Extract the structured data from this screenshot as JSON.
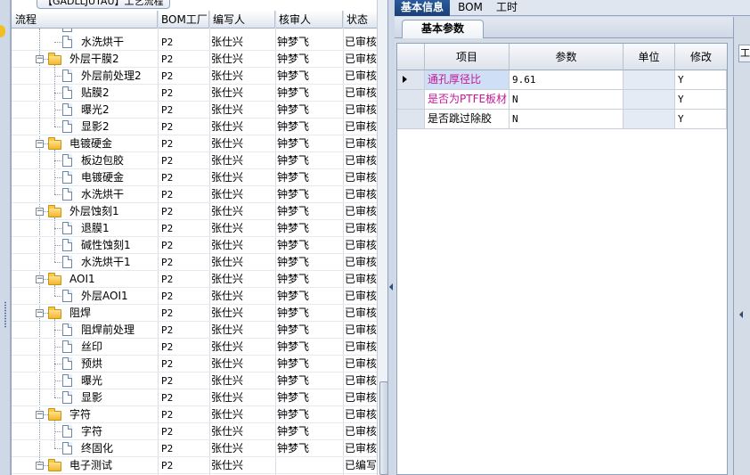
{
  "tree_panel": {
    "tab_title": "【GADLLJUTAU】工艺流程",
    "columns": [
      "流程",
      "BOM工厂",
      "编写人",
      "核审人",
      "状态"
    ]
  },
  "tree_rows": [
    {
      "level": 2,
      "type": "file",
      "name": "水洗烘干",
      "bom": "P2",
      "author": "张仕兴",
      "reviewer": "钟梦飞",
      "status": "已审核"
    },
    {
      "level": 1,
      "type": "folder",
      "name": "外层干膜2",
      "bom": "P2",
      "author": "张仕兴",
      "reviewer": "钟梦飞",
      "status": "已审核"
    },
    {
      "level": 2,
      "type": "file",
      "name": "外层前处理2",
      "bom": "P2",
      "author": "张仕兴",
      "reviewer": "钟梦飞",
      "status": "已审核"
    },
    {
      "level": 2,
      "type": "file",
      "name": "贴膜2",
      "bom": "P2",
      "author": "张仕兴",
      "reviewer": "钟梦飞",
      "status": "已审核"
    },
    {
      "level": 2,
      "type": "file",
      "name": "曝光2",
      "bom": "P2",
      "author": "张仕兴",
      "reviewer": "钟梦飞",
      "status": "已审核"
    },
    {
      "level": 2,
      "type": "file",
      "name": "显影2",
      "bom": "P2",
      "author": "张仕兴",
      "reviewer": "钟梦飞",
      "status": "已审核"
    },
    {
      "level": 1,
      "type": "folder",
      "name": "电镀硬金",
      "bom": "P2",
      "author": "张仕兴",
      "reviewer": "钟梦飞",
      "status": "已审核"
    },
    {
      "level": 2,
      "type": "file",
      "name": "板边包胶",
      "bom": "P2",
      "author": "张仕兴",
      "reviewer": "钟梦飞",
      "status": "已审核"
    },
    {
      "level": 2,
      "type": "file",
      "name": "电镀硬金",
      "bom": "P2",
      "author": "张仕兴",
      "reviewer": "钟梦飞",
      "status": "已审核"
    },
    {
      "level": 2,
      "type": "file",
      "name": "水洗烘干",
      "bom": "P2",
      "author": "张仕兴",
      "reviewer": "钟梦飞",
      "status": "已审核"
    },
    {
      "level": 1,
      "type": "folder",
      "name": "外层蚀刻1",
      "bom": "P2",
      "author": "张仕兴",
      "reviewer": "钟梦飞",
      "status": "已审核"
    },
    {
      "level": 2,
      "type": "file",
      "name": "退膜1",
      "bom": "P2",
      "author": "张仕兴",
      "reviewer": "钟梦飞",
      "status": "已审核"
    },
    {
      "level": 2,
      "type": "file",
      "name": "碱性蚀刻1",
      "bom": "P2",
      "author": "张仕兴",
      "reviewer": "钟梦飞",
      "status": "已审核"
    },
    {
      "level": 2,
      "type": "file",
      "name": "水洗烘干1",
      "bom": "P2",
      "author": "张仕兴",
      "reviewer": "钟梦飞",
      "status": "已审核"
    },
    {
      "level": 1,
      "type": "folder",
      "name": "AOI1",
      "bom": "P2",
      "author": "张仕兴",
      "reviewer": "钟梦飞",
      "status": "已审核"
    },
    {
      "level": 2,
      "type": "file",
      "name": "外层AOI1",
      "bom": "P2",
      "author": "张仕兴",
      "reviewer": "钟梦飞",
      "status": "已审核"
    },
    {
      "level": 1,
      "type": "folder",
      "name": "阻焊",
      "bom": "P2",
      "author": "张仕兴",
      "reviewer": "钟梦飞",
      "status": "已审核"
    },
    {
      "level": 2,
      "type": "file",
      "name": "阻焊前处理",
      "bom": "P2",
      "author": "张仕兴",
      "reviewer": "钟梦飞",
      "status": "已审核"
    },
    {
      "level": 2,
      "type": "file",
      "name": "丝印",
      "bom": "P2",
      "author": "张仕兴",
      "reviewer": "钟梦飞",
      "status": "已审核"
    },
    {
      "level": 2,
      "type": "file",
      "name": "预烘",
      "bom": "P2",
      "author": "张仕兴",
      "reviewer": "钟梦飞",
      "status": "已审核"
    },
    {
      "level": 2,
      "type": "file",
      "name": "曝光",
      "bom": "P2",
      "author": "张仕兴",
      "reviewer": "钟梦飞",
      "status": "已审核"
    },
    {
      "level": 2,
      "type": "file",
      "name": "显影",
      "bom": "P2",
      "author": "张仕兴",
      "reviewer": "钟梦飞",
      "status": "已审核"
    },
    {
      "level": 1,
      "type": "folder",
      "name": "字符",
      "bom": "P2",
      "author": "张仕兴",
      "reviewer": "钟梦飞",
      "status": "已审核"
    },
    {
      "level": 2,
      "type": "file",
      "name": "字符",
      "bom": "P2",
      "author": "张仕兴",
      "reviewer": "钟梦飞",
      "status": "已审核"
    },
    {
      "level": 2,
      "type": "file",
      "name": "终固化",
      "bom": "P2",
      "author": "张仕兴",
      "reviewer": "钟梦飞",
      "status": "已审核"
    },
    {
      "level": 1,
      "type": "folder",
      "name": "电子测试",
      "bom": "P2",
      "author": "张仕兴",
      "reviewer": "",
      "status": "已编写"
    }
  ],
  "right_panel": {
    "top_tabs": [
      "基本信息",
      "BOM",
      "工时"
    ],
    "sub_tab": "基本参数",
    "edge_tab": "工",
    "grid_columns": [
      "项目",
      "参数",
      "单位",
      "修改"
    ],
    "grid_rows": [
      {
        "item": "通孔厚径比",
        "param": "9.61",
        "unit": "",
        "modify": "Y"
      },
      {
        "item": "是否为PTFE板材",
        "param": "N",
        "unit": "",
        "modify": "Y"
      },
      {
        "item": "是否跳过除胶",
        "param": "N",
        "unit": "",
        "modify": "Y"
      }
    ]
  },
  "colors": {
    "highlight_text": "#c21896",
    "active_tab": "#1a3f76",
    "folder": "#f1b82d"
  }
}
